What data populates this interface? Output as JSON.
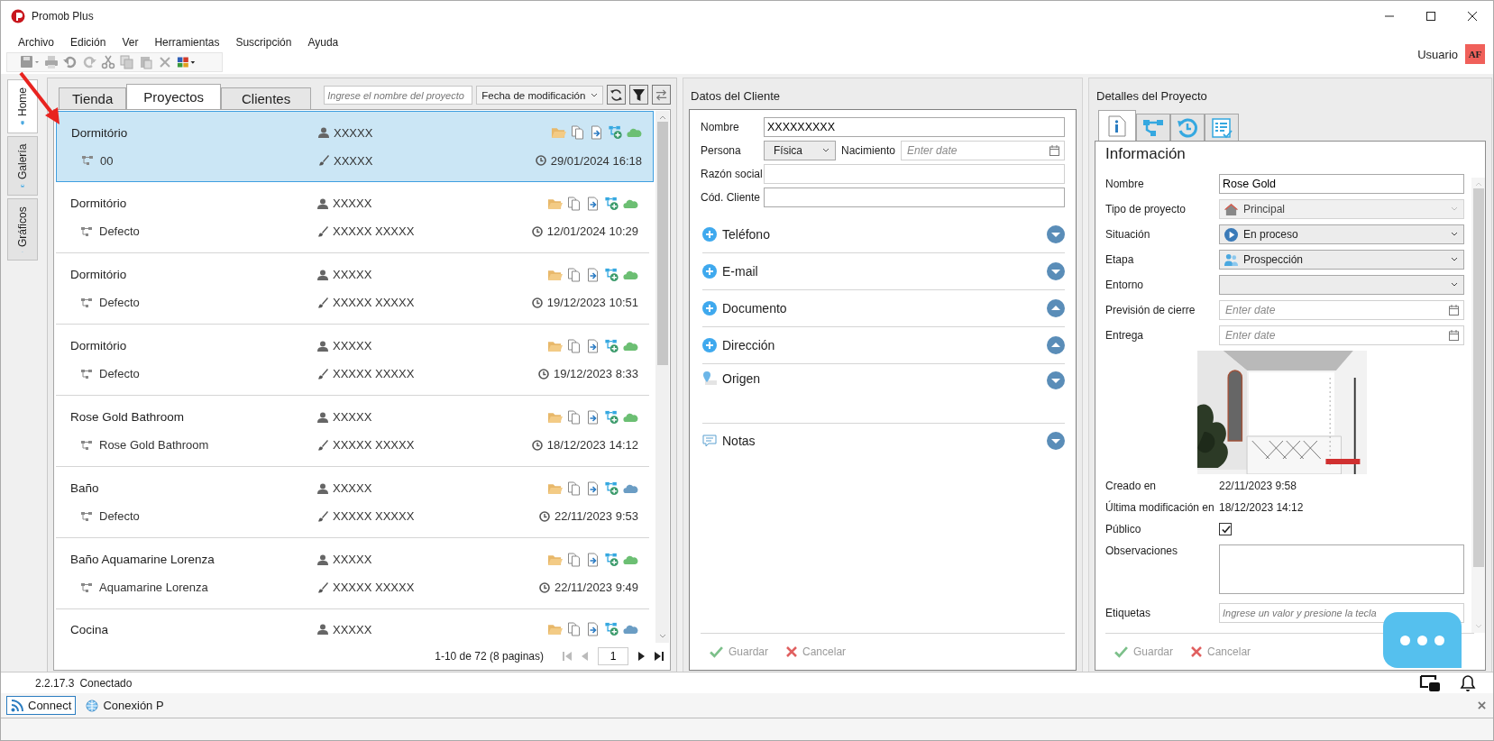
{
  "window": {
    "title": "Promob Plus"
  },
  "menu": [
    "Archivo",
    "Edición",
    "Ver",
    "Herramientas",
    "Suscripción",
    "Ayuda"
  ],
  "user": {
    "name": "Usuario",
    "initials": "AF"
  },
  "side_tabs": [
    {
      "label": "Home",
      "selected": true
    },
    {
      "label": "Galería",
      "selected": false
    },
    {
      "label": "Gráficos",
      "selected": false
    }
  ],
  "list_tabs": [
    {
      "label": "Tienda",
      "selected": false
    },
    {
      "label": "Proyectos",
      "selected": true
    },
    {
      "label": "Clientes",
      "selected": false
    }
  ],
  "search": {
    "placeholder": "Ingrese el nombre del proyecto"
  },
  "sort": {
    "value": "Fecha de modificación"
  },
  "projects": [
    {
      "name": "Dormitório",
      "owner": "XXXXX",
      "version": "00",
      "designer": "XXXXX",
      "date": "29/01/2024 16:18",
      "color": "#6cbf73",
      "selected": true
    },
    {
      "name": "Dormitório",
      "owner": "XXXXX",
      "version": "Defecto",
      "designer": "XXXXX XXXXX",
      "date": "12/01/2024 10:29",
      "color": "#6cbf73",
      "selected": false
    },
    {
      "name": "Dormitório",
      "owner": "XXXXX",
      "version": "Defecto",
      "designer": "XXXXX XXXXX",
      "date": "19/12/2023 10:51",
      "color": "#6cbf73",
      "selected": false
    },
    {
      "name": "Dormitório",
      "owner": "XXXXX",
      "version": "Defecto",
      "designer": "XXXXX XXXXX",
      "date": "19/12/2023 8:33",
      "color": "#6cbf73",
      "selected": false
    },
    {
      "name": "Rose Gold Bathroom",
      "owner": "XXXXX",
      "version": "Rose Gold Bathroom",
      "designer": "XXXXX XXXXX",
      "date": "18/12/2023 14:12",
      "color": "#6cbf73",
      "selected": false
    },
    {
      "name": "Baño",
      "owner": "XXXXX",
      "version": "Defecto",
      "designer": "XXXXX XXXXX",
      "date": "22/11/2023 9:53",
      "color": "#6b9dc4",
      "selected": false
    },
    {
      "name": "Baño Aquamarine Lorenza",
      "owner": "XXXXX",
      "version": "Aquamarine Lorenza",
      "designer": "XXXXX XXXXX",
      "date": "22/11/2023 9:49",
      "color": "#6cbf73",
      "selected": false
    },
    {
      "name": "Cocina",
      "owner": "XXXXX",
      "color": "#6b9dc4",
      "selected": false
    }
  ],
  "pager": {
    "summary": "1-10 de 72 (8 paginas)",
    "page": "1"
  },
  "client": {
    "title": "Datos del Cliente",
    "name": {
      "label": "Nombre",
      "value": "XXXXXXXXX"
    },
    "person": {
      "label": "Persona",
      "value": "Física"
    },
    "birth": {
      "label": "Nacimiento",
      "placeholder": "Enter date"
    },
    "company": {
      "label": "Razón social"
    },
    "code": {
      "label": "Cód. Cliente"
    },
    "sections": [
      {
        "kind": "add",
        "label": "Teléfono",
        "expanded": false
      },
      {
        "kind": "add",
        "label": "E-mail",
        "expanded": false
      },
      {
        "kind": "add",
        "label": "Documento",
        "expanded": true
      },
      {
        "kind": "add",
        "label": "Dirección",
        "expanded": true
      },
      {
        "kind": "location",
        "label": "Origen",
        "expanded": false
      },
      {
        "kind": "notes",
        "label": "Notas",
        "expanded": false
      }
    ],
    "actions": [
      {
        "kind": "save",
        "label": "Guardar",
        "disabled": true
      },
      {
        "kind": "cancel",
        "label": "Cancelar",
        "disabled": true
      }
    ]
  },
  "details": {
    "title": "Detalles del Proyecto",
    "tabs": [
      {
        "kind": "info",
        "selected": true
      },
      {
        "kind": "tree",
        "selected": false
      },
      {
        "kind": "history",
        "selected": false
      },
      {
        "kind": "checklist",
        "selected": false
      }
    ],
    "heading": "Información",
    "fields": [
      {
        "kind": "text",
        "label": "Nombre",
        "value": "Rose Gold"
      },
      {
        "kind": "combo",
        "label": "Tipo de proyecto",
        "value": "Principal",
        "disabled": true
      },
      {
        "kind": "combo",
        "label": "Situación",
        "value": "En proceso",
        "disabled": false
      },
      {
        "kind": "combo",
        "label": "Etapa",
        "value": "Prospección",
        "disabled": false
      },
      {
        "kind": "combo",
        "label": "Entorno",
        "disabled": false
      },
      {
        "kind": "date",
        "label": "Previsión de cierre",
        "placeholder": "Enter date"
      },
      {
        "kind": "date",
        "label": "Entrega",
        "placeholder": "Enter date"
      }
    ],
    "info": [
      {
        "label": "Creado en",
        "value": "22/11/2023 9:58"
      },
      {
        "label": "Última modificación en",
        "value": "18/12/2023 14:12"
      }
    ],
    "public": {
      "label": "Público",
      "checked": true
    },
    "notes": {
      "label": "Observaciones"
    },
    "tags": {
      "label": "Etiquetas",
      "placeholder": "Ingrese un valor y presione la tecla"
    },
    "actions": [
      {
        "kind": "save",
        "label": "Guardar",
        "disabled": true
      },
      {
        "kind": "cancel",
        "label": "Cancelar",
        "disabled": true
      }
    ]
  },
  "status": {
    "version": "2.2.17.3",
    "state": "Conectado"
  },
  "taskbar": [
    {
      "label": "Connect",
      "selected": true
    },
    {
      "label": "Conexión P",
      "selected": false
    }
  ]
}
